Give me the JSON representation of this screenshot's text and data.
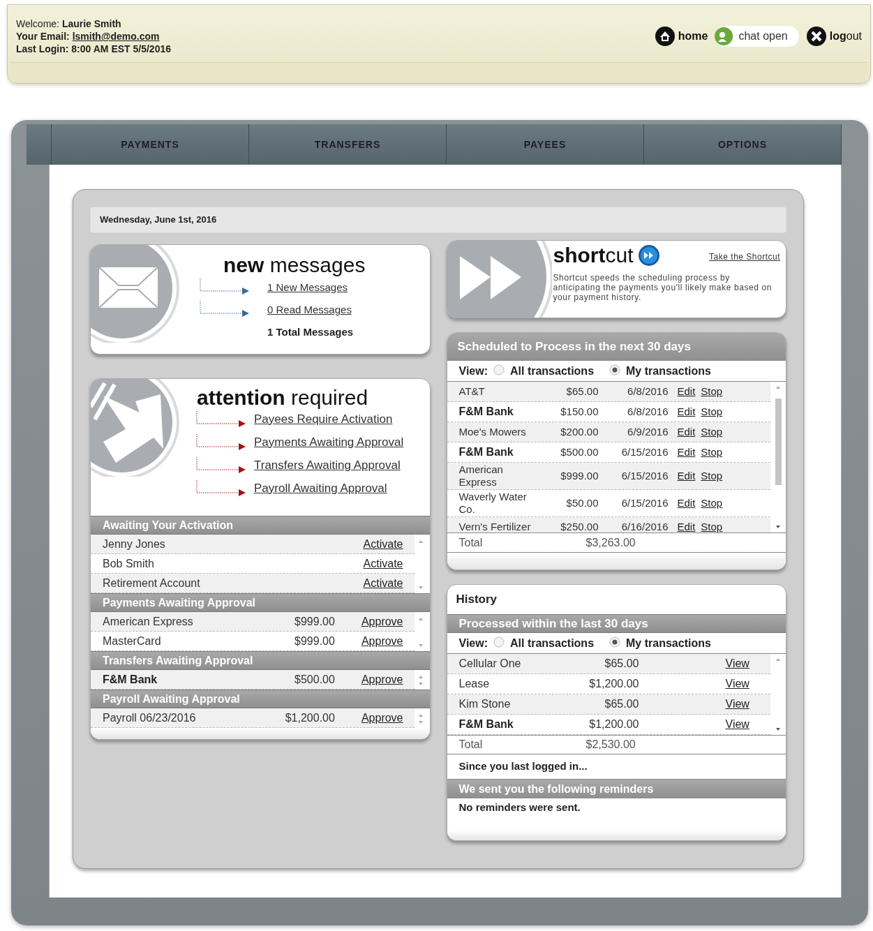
{
  "header": {
    "welcome_label": "Welcome:",
    "user": "Laurie Smith",
    "email_label": "Your Email:",
    "email": "lsmith@demo.com",
    "last_login": "Last Login: 8:00 AM EST 5/5/2016",
    "links": [
      {
        "kind": "home",
        "label": "**home**"
      },
      {
        "kind": "chat",
        "label": "chat open"
      },
      {
        "kind": "logout",
        "label": "**log**out"
      }
    ]
  },
  "nav_tabs": [
    {
      "label": "PAYMENTS",
      "selected": false
    },
    {
      "label": "TRANSFERS",
      "selected": false
    },
    {
      "label": "PAYEES",
      "selected": false
    },
    {
      "label": "OPTIONS",
      "selected": false
    }
  ],
  "date": "Wednesday, June 1st, 2016",
  "messages": {
    "title": "**new** messages",
    "links": [
      "1 New Messages",
      "0 Read Messages"
    ],
    "total": "1 Total Messages"
  },
  "attention": {
    "title": "**attention** required",
    "links": [
      "Payees Require Activation",
      "Payments Awaiting Approval",
      "Transfers Awaiting Approval",
      "Payroll Awaiting Approval"
    ],
    "sections": [
      {
        "header": "Awaiting Your Activation",
        "rows": [
          {
            "name": "Jenny Jones",
            "action": "Activate",
            "bold": false
          },
          {
            "name": "Bob Smith",
            "action": "Activate",
            "bold": false
          },
          {
            "name": "Retirement Account",
            "action": "Activate",
            "bold": false
          }
        ]
      },
      {
        "header": "Payments Awaiting Approval",
        "rows": [
          {
            "name": "American Express",
            "amount": "$999.00",
            "action": "Approve",
            "bold": false
          },
          {
            "name": "MasterCard",
            "amount": "$999.00",
            "action": "Approve",
            "bold": false
          }
        ]
      },
      {
        "header": "Transfers Awaiting Approval",
        "rows": [
          {
            "name": "F&M Bank",
            "amount": "$500.00",
            "action": "Approve",
            "bold": true
          }
        ]
      },
      {
        "header": "Payroll Awaiting Approval",
        "rows": [
          {
            "name": "Payroll 06/23/2016",
            "amount": "$1,200.00",
            "action": "Approve",
            "bold": false
          }
        ]
      }
    ]
  },
  "shortcut": {
    "title": "**short**cut",
    "link": "Take the Shortcut",
    "description": "Shortcut speeds the scheduling process by anticipating the payments you'll likely make based on your payment history."
  },
  "scheduled": {
    "header": "Scheduled to Process in the next 30 days",
    "view_label": "View:",
    "options": [
      {
        "label": "All transactions",
        "selected": false
      },
      {
        "label": "My transactions",
        "selected": true
      }
    ],
    "rows": [
      {
        "payee": "AT&T",
        "amount": "$65.00",
        "date": "6/8/2016",
        "edit": "Edit",
        "stop": "Stop",
        "bold": false
      },
      {
        "payee": "F&M Bank",
        "amount": "$150.00",
        "date": "6/8/2016",
        "edit": "Edit",
        "stop": "Stop",
        "bold": true
      },
      {
        "payee": "Moe's Mowers",
        "amount": "$200.00",
        "date": "6/9/2016",
        "edit": "Edit",
        "stop": "Stop",
        "bold": false
      },
      {
        "payee": "F&M Bank",
        "amount": "$500.00",
        "date": "6/15/2016",
        "edit": "Edit",
        "stop": "Stop",
        "bold": true
      },
      {
        "payee": "American Express",
        "amount": "$999.00",
        "date": "6/15/2016",
        "edit": "Edit",
        "stop": "Stop",
        "bold": false
      },
      {
        "payee": "Waverly Water Co.",
        "amount": "$50.00",
        "date": "6/15/2016",
        "edit": "Edit",
        "stop": "Stop",
        "bold": false
      },
      {
        "payee": "Vern's Fertilizer",
        "amount": "$250.00",
        "date": "6/16/2016",
        "edit": "Edit",
        "stop": "Stop",
        "bold": false
      }
    ],
    "total_label": "Total",
    "total": "$3,263.00"
  },
  "history": {
    "title": "History",
    "header": "Processed within the last 30 days",
    "view_label": "View:",
    "options": [
      {
        "label": "All transactions",
        "selected": false
      },
      {
        "label": "My transactions",
        "selected": true
      }
    ],
    "rows": [
      {
        "payee": "Cellular One",
        "amount": "$65.00",
        "action": "View",
        "bold": false
      },
      {
        "payee": "Lease",
        "amount": "$1,200.00",
        "action": "View",
        "bold": false
      },
      {
        "payee": "Kim Stone",
        "amount": "$65.00",
        "action": "View",
        "bold": false
      },
      {
        "payee": "F&M Bank",
        "amount": "$1,200.00",
        "action": "View",
        "bold": true
      }
    ],
    "total_label": "Total",
    "total": "$2,530.00"
  },
  "reminders": {
    "intro": "Since you last logged in...",
    "header": "We sent you the following reminders",
    "message": "No reminders were sent."
  }
}
